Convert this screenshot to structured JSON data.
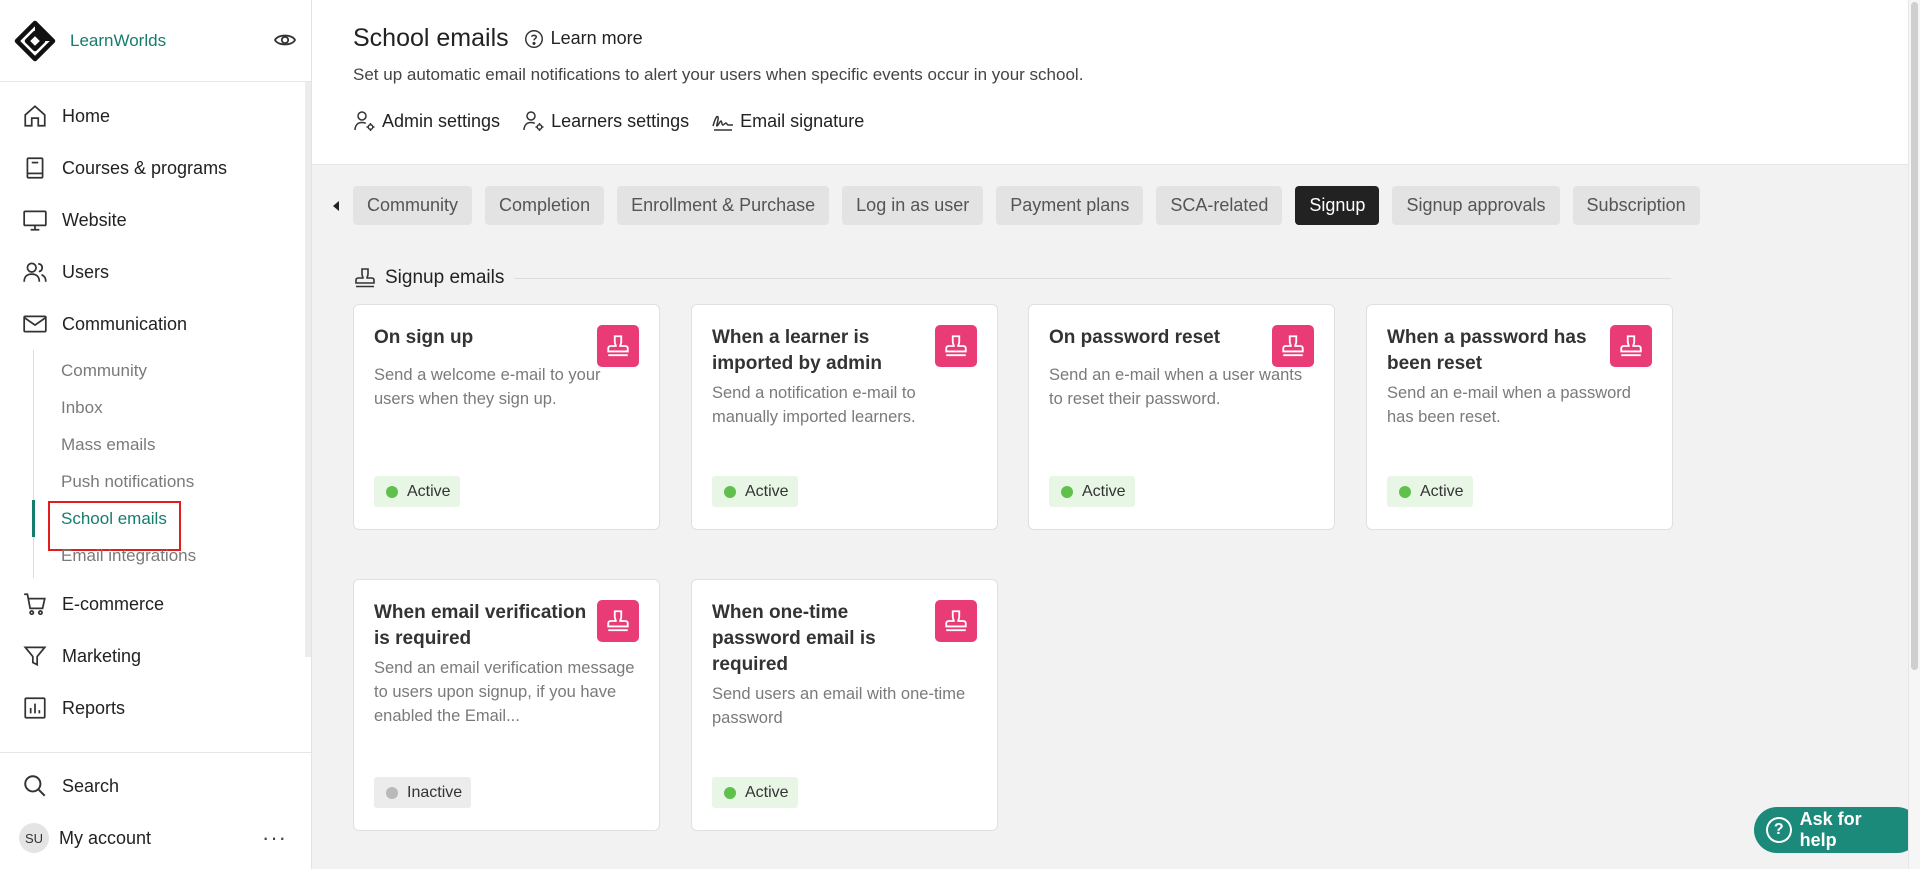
{
  "brand": {
    "name": "LearnWorlds",
    "logo_icon": "learnworlds-logo-icon",
    "preview_icon": "eye-icon"
  },
  "sidebar": {
    "items": [
      {
        "label": "Home",
        "icon": "home-icon"
      },
      {
        "label": "Courses & programs",
        "icon": "book-icon"
      },
      {
        "label": "Website",
        "icon": "monitor-icon"
      },
      {
        "label": "Users",
        "icon": "users-icon"
      },
      {
        "label": "Communication",
        "icon": "mail-icon"
      }
    ],
    "communication_sub": [
      {
        "label": "Community"
      },
      {
        "label": "Inbox"
      },
      {
        "label": "Mass emails"
      },
      {
        "label": "Push notifications"
      },
      {
        "label": "School emails",
        "active": true
      },
      {
        "label": "Email integrations"
      }
    ],
    "items_after": [
      {
        "label": "E-commerce",
        "icon": "cart-icon"
      },
      {
        "label": "Marketing",
        "icon": "funnel-icon"
      },
      {
        "label": "Reports",
        "icon": "chart-icon"
      }
    ],
    "bottom": {
      "search_label": "Search",
      "account_label": "My account",
      "avatar_initials": "SU",
      "more_label": "···"
    }
  },
  "header": {
    "title": "School emails",
    "learn_more": "Learn more",
    "subtitle": "Set up automatic email notifications to alert your users when specific events occur in your school.",
    "links": [
      {
        "label": "Admin settings",
        "icon": "user-gear-icon"
      },
      {
        "label": "Learners settings",
        "icon": "user-gear-icon"
      },
      {
        "label": "Email signature",
        "icon": "signature-icon"
      }
    ]
  },
  "tabs": [
    {
      "label": "Community"
    },
    {
      "label": "Completion"
    },
    {
      "label": "Enrollment & Purchase"
    },
    {
      "label": "Log in as user"
    },
    {
      "label": "Payment plans"
    },
    {
      "label": "SCA-related"
    },
    {
      "label": "Signup",
      "active": true
    },
    {
      "label": "Signup approvals"
    },
    {
      "label": "Subscription"
    }
  ],
  "section": {
    "title": "Signup emails",
    "icon": "stamp-icon"
  },
  "cards": [
    {
      "title": "On sign up",
      "description": "Send a welcome e-mail to your users when they sign up.",
      "status": "Active"
    },
    {
      "title": "When a learner is imported by admin",
      "description": "Send a notification e-mail to manually imported learners.",
      "status": "Active"
    },
    {
      "title": "On password reset",
      "description": "Send an e-mail when a user wants to reset their password.",
      "status": "Active"
    },
    {
      "title": "When a password has been reset",
      "description": "Send an e-mail when a password has been reset.",
      "status": "Active"
    },
    {
      "title": "When email verification is required",
      "description": "Send an email verification message to users upon signup, if you have enabled the Email...",
      "status": "Inactive"
    },
    {
      "title": "When one-time password email is required",
      "description": "Send users an email with one-time password",
      "status": "Active"
    }
  ],
  "help": {
    "label": "Ask for help",
    "icon": "question-icon"
  },
  "colors": {
    "accent": "#157d6e",
    "card_icon": "#e93b76",
    "active_tab": "#222222",
    "status_active": "#5fc04c",
    "status_inactive": "#b9b9b9",
    "highlight_box": "#e21d1d",
    "help_button": "#1b8a7a"
  }
}
